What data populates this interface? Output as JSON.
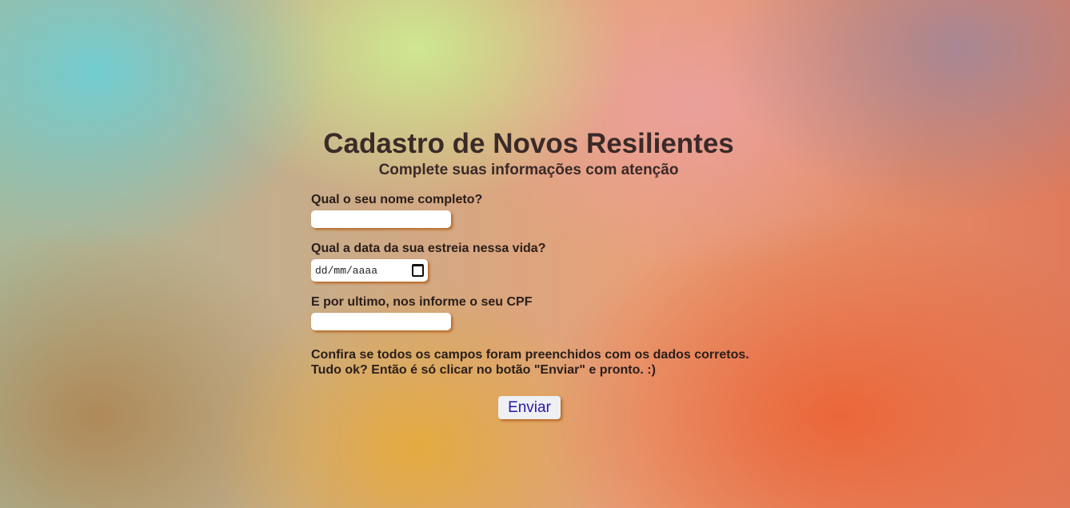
{
  "header": {
    "title": "Cadastro de Novos Resilientes",
    "subtitle": "Complete suas informações com atenção"
  },
  "form": {
    "name_label": "Qual o seu nome completo?",
    "name_value": "",
    "birth_label": "Qual a data da sua estreia nessa vida?",
    "birth_placeholder": "dd/mm/aaaa",
    "cpf_label": "E por ultimo, nos informe o seu CPF",
    "cpf_value": "",
    "confirm_line1": "Confira se todos os campos foram preenchidos com os dados corretos.",
    "confirm_line2": "Tudo ok? Então é só clicar no botão \"Enviar\" e pronto. :)",
    "submit_label": "Enviar"
  }
}
